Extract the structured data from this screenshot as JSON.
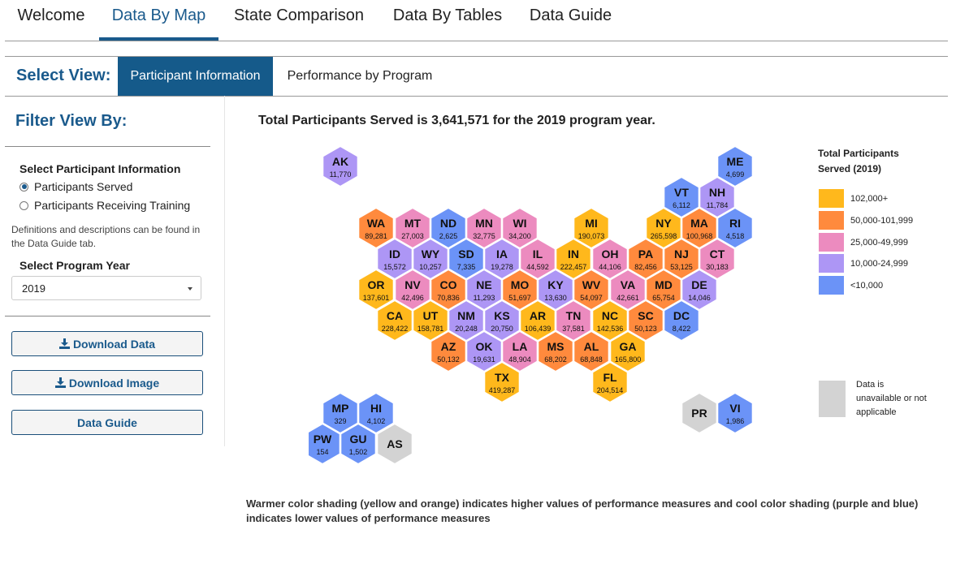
{
  "nav": {
    "tabs": [
      {
        "label": "Welcome",
        "active": false
      },
      {
        "label": "Data By Map",
        "active": true
      },
      {
        "label": "State Comparison",
        "active": false
      },
      {
        "label": "Data By Tables",
        "active": false
      },
      {
        "label": "Data Guide",
        "active": false
      }
    ]
  },
  "view": {
    "label": "Select View:",
    "tabs": [
      {
        "label": "Participant Information",
        "active": true
      },
      {
        "label": "Performance by Program",
        "active": false
      }
    ]
  },
  "sidebar": {
    "title": "Filter View By:",
    "participant_label": "Select Participant Information",
    "options": [
      {
        "label": "Participants Served",
        "selected": true
      },
      {
        "label": "Participants Receiving Training",
        "selected": false
      }
    ],
    "note": "Definitions and descriptions can be found in the Data Guide tab.",
    "year_label": "Select Program Year",
    "year_value": "2019",
    "buttons": {
      "download_data": "Download Data",
      "download_image": "Download Image",
      "data_guide": "Data Guide"
    }
  },
  "map": {
    "title": "Total Participants Served is 3,641,571 for the 2019 program year.",
    "colors": {
      "c5": "#ffb81c",
      "c4": "#ff8a3d",
      "c3": "#ec8bbf",
      "c2": "#ad96f5",
      "c1": "#6b93f7",
      "na": "#d3d3d3"
    },
    "states": [
      {
        "abbr": "AK",
        "value": "11,770",
        "cls": "c2"
      },
      {
        "abbr": "ME",
        "value": "4,699",
        "cls": "c1"
      },
      {
        "abbr": "VT",
        "value": "6,112",
        "cls": "c1"
      },
      {
        "abbr": "NH",
        "value": "11,784",
        "cls": "c2"
      },
      {
        "abbr": "WA",
        "value": "89,281",
        "cls": "c4"
      },
      {
        "abbr": "MT",
        "value": "27,003",
        "cls": "c3"
      },
      {
        "abbr": "ND",
        "value": "2,625",
        "cls": "c1"
      },
      {
        "abbr": "MN",
        "value": "32,775",
        "cls": "c3"
      },
      {
        "abbr": "WI",
        "value": "34,200",
        "cls": "c3"
      },
      {
        "abbr": "MI",
        "value": "190,073",
        "cls": "c5"
      },
      {
        "abbr": "NY",
        "value": "265,598",
        "cls": "c5"
      },
      {
        "abbr": "MA",
        "value": "100,968",
        "cls": "c4"
      },
      {
        "abbr": "RI",
        "value": "4,518",
        "cls": "c1"
      },
      {
        "abbr": "ID",
        "value": "15,572",
        "cls": "c2"
      },
      {
        "abbr": "WY",
        "value": "10,257",
        "cls": "c2"
      },
      {
        "abbr": "SD",
        "value": "7,335",
        "cls": "c1"
      },
      {
        "abbr": "IA",
        "value": "19,278",
        "cls": "c2"
      },
      {
        "abbr": "IL",
        "value": "44,592",
        "cls": "c3"
      },
      {
        "abbr": "IN",
        "value": "222,457",
        "cls": "c5"
      },
      {
        "abbr": "OH",
        "value": "44,106",
        "cls": "c3"
      },
      {
        "abbr": "PA",
        "value": "82,456",
        "cls": "c4"
      },
      {
        "abbr": "NJ",
        "value": "53,125",
        "cls": "c4"
      },
      {
        "abbr": "CT",
        "value": "30,183",
        "cls": "c3"
      },
      {
        "abbr": "OR",
        "value": "137,601",
        "cls": "c5"
      },
      {
        "abbr": "NV",
        "value": "42,496",
        "cls": "c3"
      },
      {
        "abbr": "CO",
        "value": "70,836",
        "cls": "c4"
      },
      {
        "abbr": "NE",
        "value": "11,293",
        "cls": "c2"
      },
      {
        "abbr": "MO",
        "value": "51,697",
        "cls": "c4"
      },
      {
        "abbr": "KY",
        "value": "13,630",
        "cls": "c2"
      },
      {
        "abbr": "WV",
        "value": "54,097",
        "cls": "c4"
      },
      {
        "abbr": "VA",
        "value": "42,661",
        "cls": "c3"
      },
      {
        "abbr": "MD",
        "value": "65,754",
        "cls": "c4"
      },
      {
        "abbr": "DE",
        "value": "14,046",
        "cls": "c2"
      },
      {
        "abbr": "CA",
        "value": "228,422",
        "cls": "c5"
      },
      {
        "abbr": "UT",
        "value": "158,781",
        "cls": "c5"
      },
      {
        "abbr": "NM",
        "value": "20,248",
        "cls": "c2"
      },
      {
        "abbr": "KS",
        "value": "20,750",
        "cls": "c2"
      },
      {
        "abbr": "AR",
        "value": "106,439",
        "cls": "c5"
      },
      {
        "abbr": "TN",
        "value": "37,581",
        "cls": "c3"
      },
      {
        "abbr": "NC",
        "value": "142,536",
        "cls": "c5"
      },
      {
        "abbr": "SC",
        "value": "50,123",
        "cls": "c4"
      },
      {
        "abbr": "DC",
        "value": "8,422",
        "cls": "c1"
      },
      {
        "abbr": "AZ",
        "value": "50,132",
        "cls": "c4"
      },
      {
        "abbr": "OK",
        "value": "19,631",
        "cls": "c2"
      },
      {
        "abbr": "LA",
        "value": "48,904",
        "cls": "c3"
      },
      {
        "abbr": "MS",
        "value": "68,202",
        "cls": "c4"
      },
      {
        "abbr": "AL",
        "value": "68,848",
        "cls": "c4"
      },
      {
        "abbr": "GA",
        "value": "165,800",
        "cls": "c5"
      },
      {
        "abbr": "TX",
        "value": "419,287",
        "cls": "c5"
      },
      {
        "abbr": "FL",
        "value": "204,514",
        "cls": "c5"
      },
      {
        "abbr": "MP",
        "value": "329",
        "cls": "c1"
      },
      {
        "abbr": "HI",
        "value": "4,102",
        "cls": "c1"
      },
      {
        "abbr": "PW",
        "value": "154",
        "cls": "c1"
      },
      {
        "abbr": "GU",
        "value": "1,502",
        "cls": "c1"
      },
      {
        "abbr": "AS",
        "value": "",
        "cls": "na"
      },
      {
        "abbr": "PR",
        "value": "",
        "cls": "na"
      },
      {
        "abbr": "VI",
        "value": "1,986",
        "cls": "c1"
      }
    ]
  },
  "legend": {
    "title": "Total Participants Served (2019)",
    "items": [
      {
        "label": "102,000+",
        "cls": "c5"
      },
      {
        "label": "50,000-101,999",
        "cls": "c4"
      },
      {
        "label": "25,000-49,999",
        "cls": "c3"
      },
      {
        "label": "10,000-24,999",
        "cls": "c2"
      },
      {
        "label": "<10,000",
        "cls": "c1"
      }
    ],
    "na_label": "Data is unavailable or not applicable"
  },
  "footnote": "Warmer color shading (yellow and orange) indicates higher values of performance measures and cool color shading (purple and blue) indicates lower values of performance measures"
}
